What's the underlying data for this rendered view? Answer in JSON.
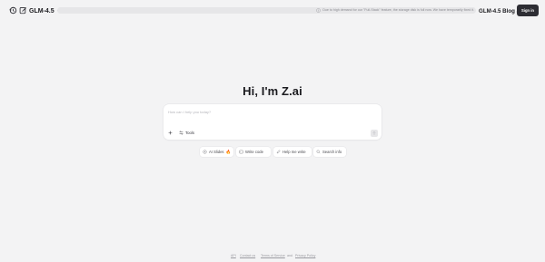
{
  "header": {
    "model_name": "GLM-4.5",
    "banner_text": "Due to high demand for our \"Full-Stack\" feature, the storage disk is full now. We have temporarily fixed it.",
    "blog_label": "GLM-4.5 Blog",
    "signin_label": "Sign in"
  },
  "main": {
    "greeting": "Hi, I'm Z.ai",
    "input_placeholder": "How can I help you today?",
    "tools_label": "Tools"
  },
  "chips": [
    {
      "label": "AI Slides",
      "icon": "sparkle-icon",
      "emoji": "🔥"
    },
    {
      "label": "Write code",
      "icon": "code-icon"
    },
    {
      "label": "Help me write",
      "icon": "pen-icon"
    },
    {
      "label": "Search info",
      "icon": "search-icon"
    }
  ],
  "footer": {
    "about": "API",
    "contact": "Contact us",
    "terms": "Terms of Service",
    "and": "and",
    "privacy": "Privacy Policy"
  },
  "colors": {
    "background": "#f3f3f4",
    "signin_bg": "#2d2d33",
    "text": "#1b1b1f"
  }
}
